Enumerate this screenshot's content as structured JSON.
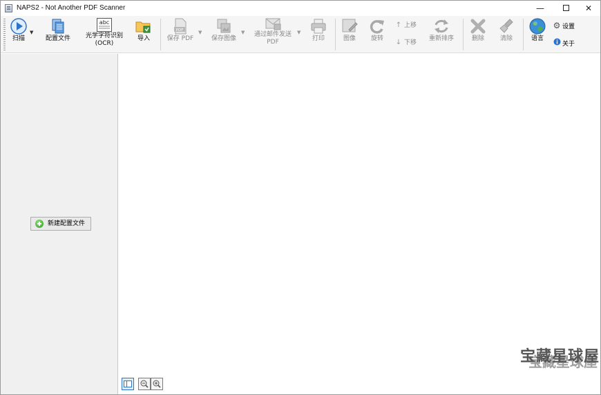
{
  "window": {
    "title": "NAPS2 - Not Another PDF Scanner",
    "controls": {
      "minimize": "—",
      "close": "✕"
    }
  },
  "toolbar": {
    "scan": "扫描",
    "profiles": "配置文件",
    "ocr_line1": "光学字符识别",
    "ocr_line2": "(OCR)",
    "ocr_icon_text": "abc",
    "import": "导入",
    "save_pdf": "保存 PDF",
    "pdf_icon_text": "PDF",
    "save_images": "保存图像",
    "email_pdf_line1": "通过邮件发送",
    "email_pdf_line2": "PDF",
    "print": "打印",
    "image": "图像",
    "rotate": "旋转",
    "move_up": "上移",
    "move_down": "下移",
    "reorder": "重新排序",
    "delete": "删除",
    "clear": "清除",
    "language": "语言",
    "settings": "设置",
    "about": "关于"
  },
  "sidebar": {
    "new_profile": "新建配置文件"
  },
  "watermark": {
    "text": "宝藏星球屋"
  },
  "colors": {
    "toolbar_bg": "#f5f5f5",
    "sidebar_bg": "#f0f0f0",
    "accent_blue": "#2f72c8",
    "green": "#2f9a22"
  }
}
